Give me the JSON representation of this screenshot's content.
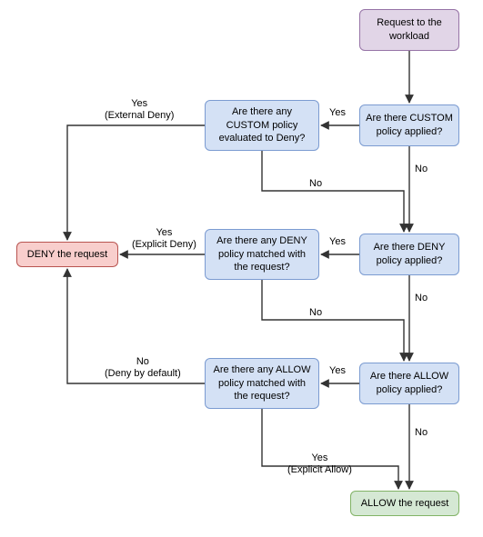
{
  "nodes": {
    "start": {
      "text": "Request to the workload"
    },
    "customApplied": {
      "text": "Are there CUSTOM policy applied?"
    },
    "customDeny": {
      "text": "Are there any CUSTOM policy evaluated to Deny?"
    },
    "denyApplied": {
      "text": "Are there DENY policy applied?"
    },
    "denyMatched": {
      "text": "Are there any DENY policy matched with the request?"
    },
    "allowApplied": {
      "text": "Are there ALLOW policy applied?"
    },
    "allowMatched": {
      "text": "Are there any ALLOW policy matched with the request?"
    },
    "deny": {
      "text": "DENY the request"
    },
    "allow": {
      "text": "ALLOW the request"
    }
  },
  "labels": {
    "yes": "Yes",
    "no": "No",
    "yesExternalDeny": "Yes\n(External Deny)",
    "yesExplicitDeny": "Yes\n(Explicit Deny)",
    "noDenyDefault": "No\n(Deny by default)",
    "yesExplicitAllow": "Yes\n(Explicit Allow)"
  },
  "chart_data": {
    "type": "flowchart",
    "nodes": [
      {
        "id": "start",
        "label": "Request to the workload",
        "kind": "start"
      },
      {
        "id": "customApplied",
        "label": "Are there CUSTOM policy applied?",
        "kind": "decision"
      },
      {
        "id": "customDeny",
        "label": "Are there any CUSTOM policy evaluated to Deny?",
        "kind": "decision"
      },
      {
        "id": "denyApplied",
        "label": "Are there DENY policy applied?",
        "kind": "decision"
      },
      {
        "id": "denyMatched",
        "label": "Are there any DENY policy matched with the request?",
        "kind": "decision"
      },
      {
        "id": "allowApplied",
        "label": "Are there ALLOW policy applied?",
        "kind": "decision"
      },
      {
        "id": "allowMatched",
        "label": "Are there any ALLOW policy matched with the request?",
        "kind": "decision"
      },
      {
        "id": "deny",
        "label": "DENY the request",
        "kind": "terminal"
      },
      {
        "id": "allow",
        "label": "ALLOW the request",
        "kind": "terminal"
      }
    ],
    "edges": [
      {
        "from": "start",
        "to": "customApplied",
        "label": ""
      },
      {
        "from": "customApplied",
        "to": "customDeny",
        "label": "Yes"
      },
      {
        "from": "customApplied",
        "to": "denyApplied",
        "label": "No"
      },
      {
        "from": "customDeny",
        "to": "deny",
        "label": "Yes (External Deny)"
      },
      {
        "from": "customDeny",
        "to": "denyApplied",
        "label": "No"
      },
      {
        "from": "denyApplied",
        "to": "denyMatched",
        "label": "Yes"
      },
      {
        "from": "denyApplied",
        "to": "allowApplied",
        "label": "No"
      },
      {
        "from": "denyMatched",
        "to": "deny",
        "label": "Yes (Explicit Deny)"
      },
      {
        "from": "denyMatched",
        "to": "allowApplied",
        "label": "No"
      },
      {
        "from": "allowApplied",
        "to": "allowMatched",
        "label": "Yes"
      },
      {
        "from": "allowApplied",
        "to": "allow",
        "label": "No"
      },
      {
        "from": "allowMatched",
        "to": "deny",
        "label": "No (Deny by default)"
      },
      {
        "from": "allowMatched",
        "to": "allow",
        "label": "Yes (Explicit Allow)"
      }
    ]
  }
}
